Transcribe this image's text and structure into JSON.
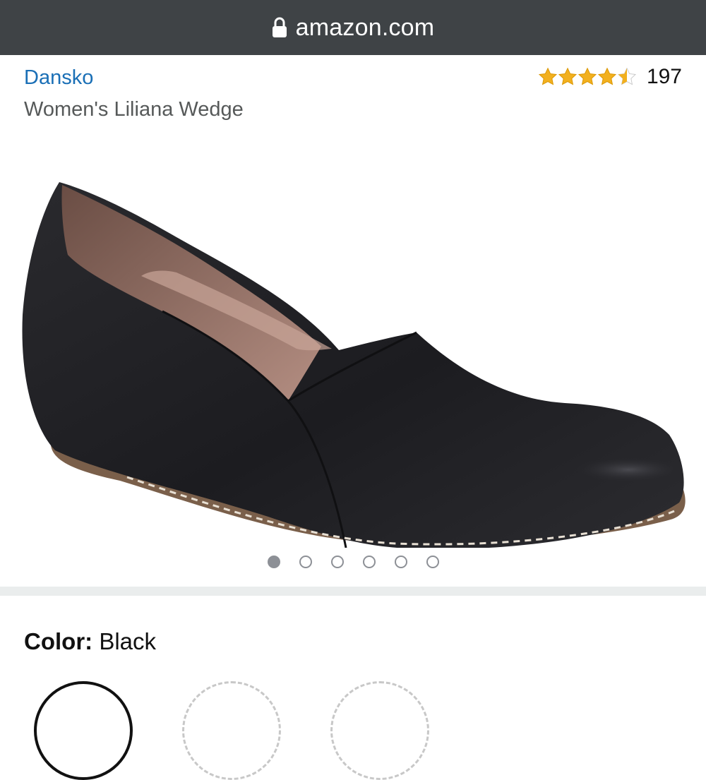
{
  "browser": {
    "url": "amazon.com",
    "lock_icon": "lock-icon"
  },
  "product": {
    "brand": "Dansko",
    "title": "Women's Liliana Wedge",
    "rating": {
      "stars": 4.5,
      "count": "197",
      "star_color": "#f2b01e"
    },
    "image_carousel": {
      "total": 6,
      "active_index": 0
    }
  },
  "variation": {
    "label": "Color:",
    "value": "Black"
  },
  "colors": {
    "urlbar_bg": "#3f4346",
    "brand_link": "#1a6fb6",
    "title_text": "#565959",
    "divider": "#eaeded"
  }
}
